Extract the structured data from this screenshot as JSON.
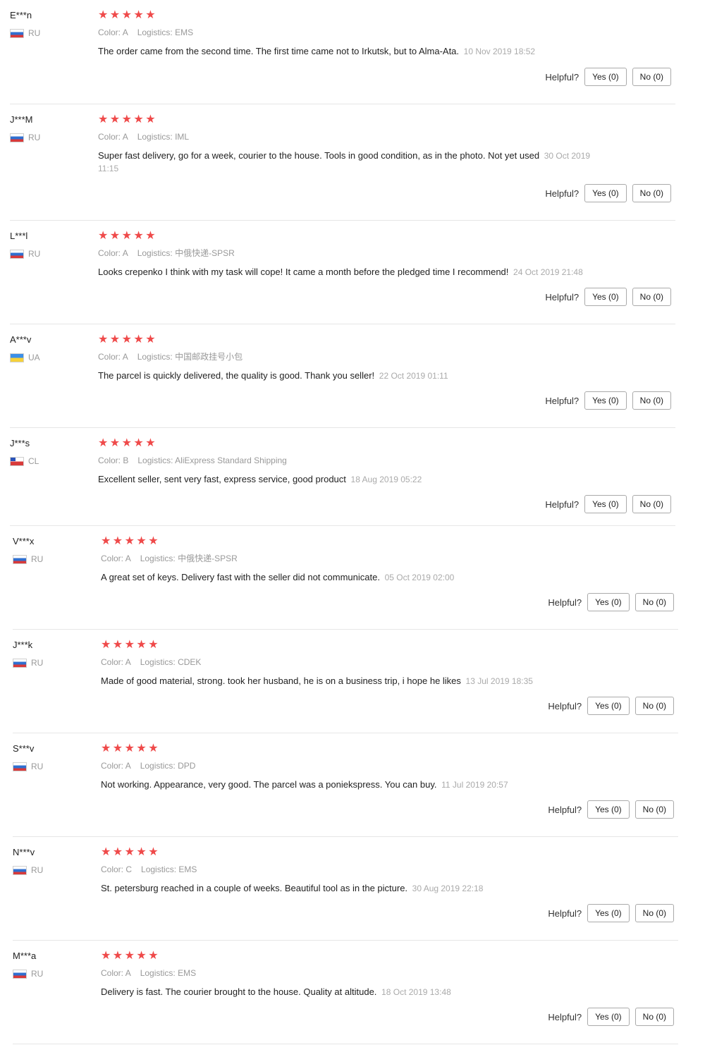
{
  "ui": {
    "helpful_label": "Helpful?",
    "color_label": "Color:",
    "logistics_label": "Logistics:",
    "star_glyph": "★",
    "accent_star": "#ef4a4a"
  },
  "reviews": [
    {
      "user": "E***n",
      "country": "RU",
      "rating": 5,
      "color": "A",
      "logistics": "EMS",
      "comment": "The order came from the second time. The first time came not to Irkutsk, but to Alma-Ata.",
      "date": "10 Nov 2019 18:52",
      "yes": "Yes (0)",
      "no": "No (0)"
    },
    {
      "user": "J***M",
      "country": "RU",
      "rating": 5,
      "color": "A",
      "logistics": "IML",
      "comment": "Super fast delivery, go for a week, courier to the house. Tools in good condition, as in the photo. Not yet used",
      "date": "30 Oct 2019 11:15",
      "yes": "Yes (0)",
      "no": "No (0)"
    },
    {
      "user": "L***l",
      "country": "RU",
      "rating": 5,
      "color": "A",
      "logistics": "中俄快递-SPSR",
      "comment": "Looks crepenko I think with my task will cope! It came a month before the pledged time I recommend!",
      "date": "24 Oct 2019 21:48",
      "yes": "Yes (0)",
      "no": "No (0)"
    },
    {
      "user": "A***v",
      "country": "UA",
      "rating": 5,
      "color": "A",
      "logistics": "中国邮政挂号小包",
      "comment": "The parcel is quickly delivered, the quality is good. Thank you seller!",
      "date": "22 Oct 2019 01:11",
      "yes": "Yes (0)",
      "no": "No (0)"
    },
    {
      "user": "J***s",
      "country": "CL",
      "rating": 5,
      "color": "B",
      "logistics": "AliExpress Standard Shipping",
      "comment": "Excellent seller, sent very fast, express service, good product",
      "date": "18 Aug 2019 05:22",
      "yes": "Yes (0)",
      "no": "No (0)"
    },
    {
      "user": "V***x",
      "country": "RU",
      "rating": 5,
      "color": "A",
      "logistics": "中俄快递-SPSR",
      "comment": "A great set of keys. Delivery fast with the seller did not communicate.",
      "date": "05 Oct 2019 02:00",
      "yes": "Yes (0)",
      "no": "No (0)"
    },
    {
      "user": "J***k",
      "country": "RU",
      "rating": 5,
      "color": "A",
      "logistics": "CDEK",
      "comment": "Made of good material, strong. took her husband, he is on a business trip, i hope he likes",
      "date": "13 Jul 2019 18:35",
      "yes": "Yes (0)",
      "no": "No (0)"
    },
    {
      "user": "S***v",
      "country": "RU",
      "rating": 5,
      "color": "A",
      "logistics": "DPD",
      "comment": "Not working. Appearance, very good. The parcel was a poniekspress. You can buy.",
      "date": "11 Jul 2019 20:57",
      "yes": "Yes (0)",
      "no": "No (0)"
    },
    {
      "user": "N***v",
      "country": "RU",
      "rating": 5,
      "color": "C",
      "logistics": "EMS",
      "comment": "St. petersburg reached in a couple of weeks. Beautiful tool as in the picture.",
      "date": "30 Aug 2019 22:18",
      "yes": "Yes (0)",
      "no": "No (0)"
    },
    {
      "user": "M***a",
      "country": "RU",
      "rating": 5,
      "color": "A",
      "logistics": "EMS",
      "comment": "Delivery is fast. The courier brought to the house. Quality at altitude.",
      "date": "18 Oct 2019 13:48",
      "yes": "Yes (0)",
      "no": "No (0)"
    }
  ]
}
